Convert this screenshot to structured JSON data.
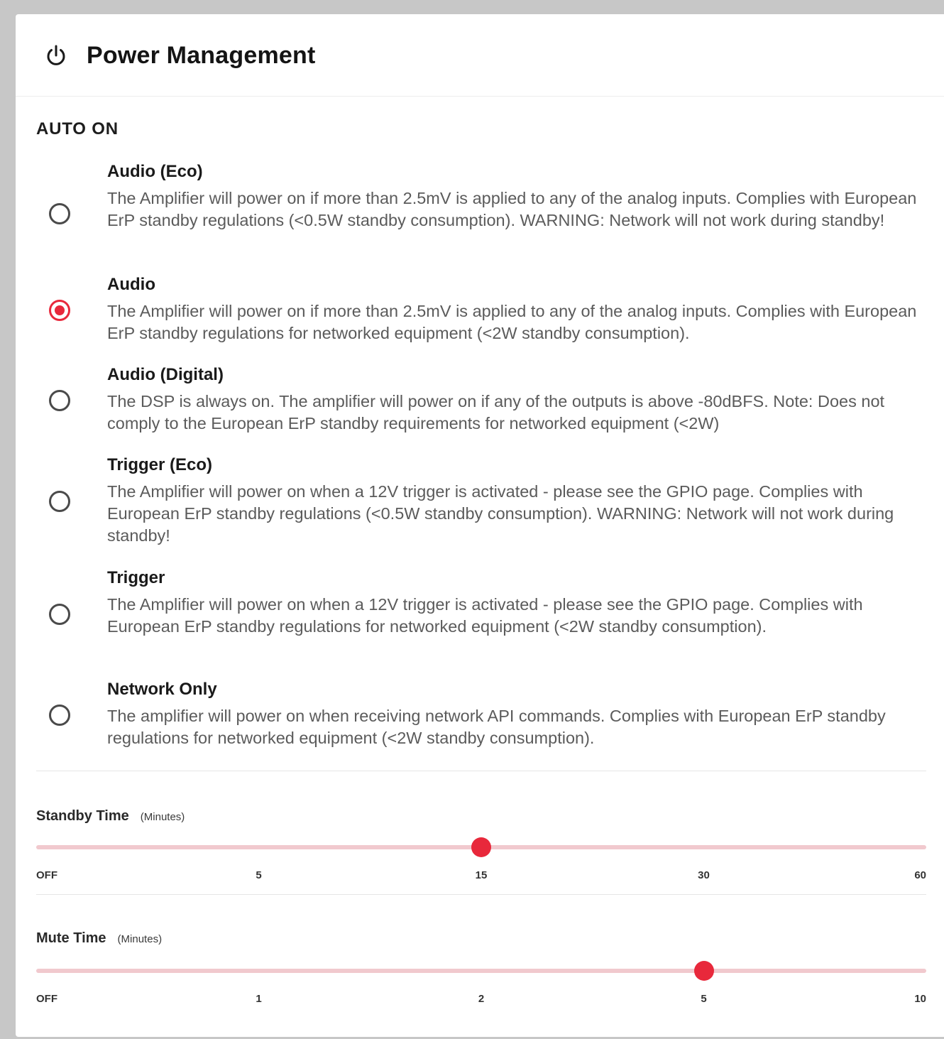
{
  "header": {
    "icon": "power-icon",
    "title": "Power Management"
  },
  "auto_on": {
    "section_title": "AUTO ON",
    "selected": "Audio",
    "options": [
      {
        "label": "Audio (Eco)",
        "description": "The Amplifier will power on if more than 2.5mV is applied to any of the analog inputs. Complies with European ErP standby regulations (<0.5W standby consumption). WARNING: Network will not work during standby!",
        "checked": false
      },
      {
        "label": "Audio",
        "description": "The Amplifier will power on if more than 2.5mV is applied to any of the analog inputs. Complies with European ErP standby regulations for networked equipment (<2W standby consumption).",
        "checked": true
      },
      {
        "label": "Audio (Digital)",
        "description": "The DSP is always on. The amplifier will power on if any of the outputs is above -80dBFS. Note: Does not comply to the European ErP standby requirements for networked equipment (<2W)",
        "checked": false
      },
      {
        "label": "Trigger (Eco)",
        "description": "The Amplifier will power on when a 12V trigger is activated - please see the GPIO page. Complies with European ErP standby regulations (<0.5W standby consumption). WARNING: Network will not work during standby!",
        "checked": false
      },
      {
        "label": "Trigger",
        "description": "The Amplifier will power on when a 12V trigger is activated - please see the GPIO page. Complies with European ErP standby regulations for networked equipment (<2W standby consumption).",
        "checked": false
      },
      {
        "label": "Network Only",
        "description": "The amplifier will power on when receiving network API commands. Complies with European ErP standby regulations for networked equipment (<2W standby consumption).",
        "checked": false
      }
    ]
  },
  "standby_time": {
    "label": "Standby Time",
    "unit": "(Minutes)",
    "ticks": [
      "OFF",
      "5",
      "15",
      "30",
      "60"
    ],
    "selected": "15"
  },
  "mute_time": {
    "label": "Mute Time",
    "unit": "(Minutes)",
    "ticks": [
      "OFF",
      "1",
      "2",
      "5",
      "10"
    ],
    "selected": "5"
  },
  "colors": {
    "accent": "#e8283b",
    "track": "#f1c9ce"
  }
}
